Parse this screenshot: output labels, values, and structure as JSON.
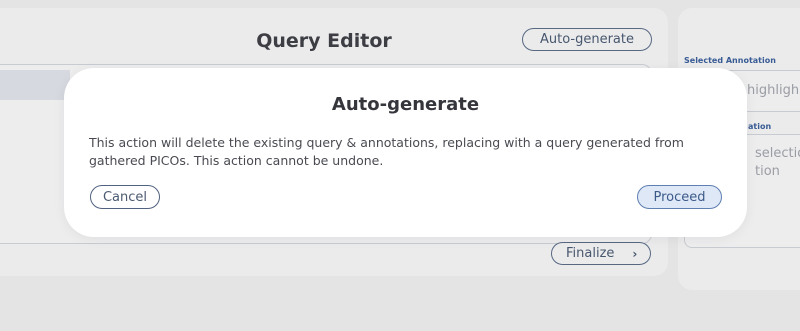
{
  "editor": {
    "title": "Query Editor",
    "autogenerate_label": "Auto-generate",
    "finalize_label": "Finalize",
    "finalize_chevron": "›"
  },
  "side_panel": {
    "selected_annotation_label": "Selected Annotation",
    "selected_annotation_placeholder": "highligh",
    "annotation_section_label": "ation",
    "annotation_text": "selection\ntion"
  },
  "modal": {
    "title": "Auto-generate",
    "body": "This action will delete the existing query & annotations, replacing with a query generated from gathered PICOs. This action cannot be undone.",
    "cancel_label": "Cancel",
    "proceed_label": "Proceed"
  },
  "colors": {
    "accent": "#5e7fb1",
    "proceed_fill": "#dfe8f7",
    "modal_bg": "#ffffff"
  }
}
